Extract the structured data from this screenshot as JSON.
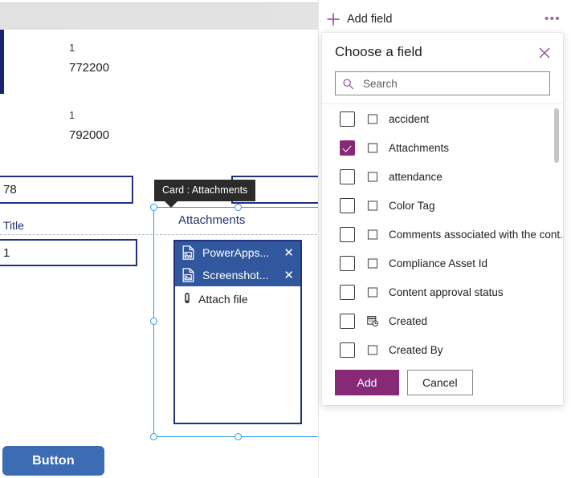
{
  "canvas": {
    "numbers": [
      {
        "small": "1",
        "big": "772200"
      },
      {
        "small": "1",
        "big": "792000"
      }
    ],
    "inputs": {
      "quantity_value": "78",
      "title_value": "1",
      "placeholder": ""
    },
    "labels": {
      "title": "Title",
      "attachments": "Attachments"
    },
    "tooltip": "Card : Attachments",
    "button_label": "Button",
    "attachments": {
      "items": [
        {
          "name": "PowerApps...",
          "icon": "image-file-icon",
          "remove": "✕"
        },
        {
          "name": "Screenshot...",
          "icon": "image-file-icon",
          "remove": "✕"
        }
      ],
      "attach_file_label": "Attach file",
      "attach_icon": "paperclip-icon"
    },
    "colors": {
      "input_border": "#21317f",
      "button_fill": "#3b6cb4",
      "selection": "#2d9ae0",
      "attachment_row": "#31589e"
    }
  },
  "panel": {
    "add_field_label": "Add field",
    "add_field_icon": "plus-icon",
    "more_options": "•••"
  },
  "flyout": {
    "title": "Choose a field",
    "close_icon": "close-icon",
    "search": {
      "icon": "search-icon",
      "value": "",
      "placeholder": "Search"
    },
    "fields": [
      {
        "label": "accident",
        "checked": false,
        "type_icon": "text-field-icon"
      },
      {
        "label": "Attachments",
        "checked": true,
        "type_icon": "text-field-icon"
      },
      {
        "label": "attendance",
        "checked": false,
        "type_icon": "text-field-icon"
      },
      {
        "label": "Color Tag",
        "checked": false,
        "type_icon": "text-field-icon"
      },
      {
        "label": "Comments associated with the cont...",
        "checked": false,
        "type_icon": "text-field-icon"
      },
      {
        "label": "Compliance Asset Id",
        "checked": false,
        "type_icon": "text-field-icon"
      },
      {
        "label": "Content approval status",
        "checked": false,
        "type_icon": "text-field-icon"
      },
      {
        "label": "Created",
        "checked": false,
        "type_icon": "date-time-icon"
      },
      {
        "label": "Created By",
        "checked": false,
        "type_icon": "text-field-icon"
      }
    ],
    "buttons": {
      "add": "Add",
      "cancel": "Cancel"
    },
    "accent_color": "#862a78"
  }
}
